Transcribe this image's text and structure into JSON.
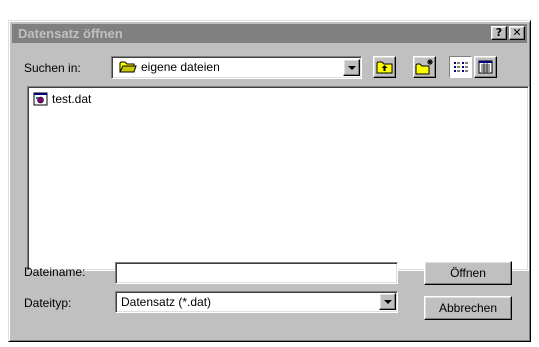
{
  "dialog": {
    "title": "Datensatz öffnen",
    "help_button": "?",
    "close_button": "✕"
  },
  "lookin": {
    "label": "Suchen in:",
    "value": "eigene dateien",
    "icon": "folder-icon"
  },
  "toolbar": {
    "up_icon": "up-one-level-icon",
    "new_folder_icon": "new-folder-icon",
    "list_icon": "list-view-icon",
    "details_icon": "details-view-icon"
  },
  "files": [
    {
      "name": "test.dat",
      "icon": "dat-file-icon"
    }
  ],
  "filename": {
    "label": "Dateiname:",
    "value": "",
    "placeholder": ""
  },
  "filetype": {
    "label": "Dateityp:",
    "value": "Datensatz (*.dat)"
  },
  "buttons": {
    "open": "Öffnen",
    "cancel": "Abbrechen"
  },
  "colors": {
    "face": "#c0c0c0",
    "title_inactive": "#808080",
    "title_text": "#c0c0c0",
    "folder_yellow": "#ffff00"
  }
}
